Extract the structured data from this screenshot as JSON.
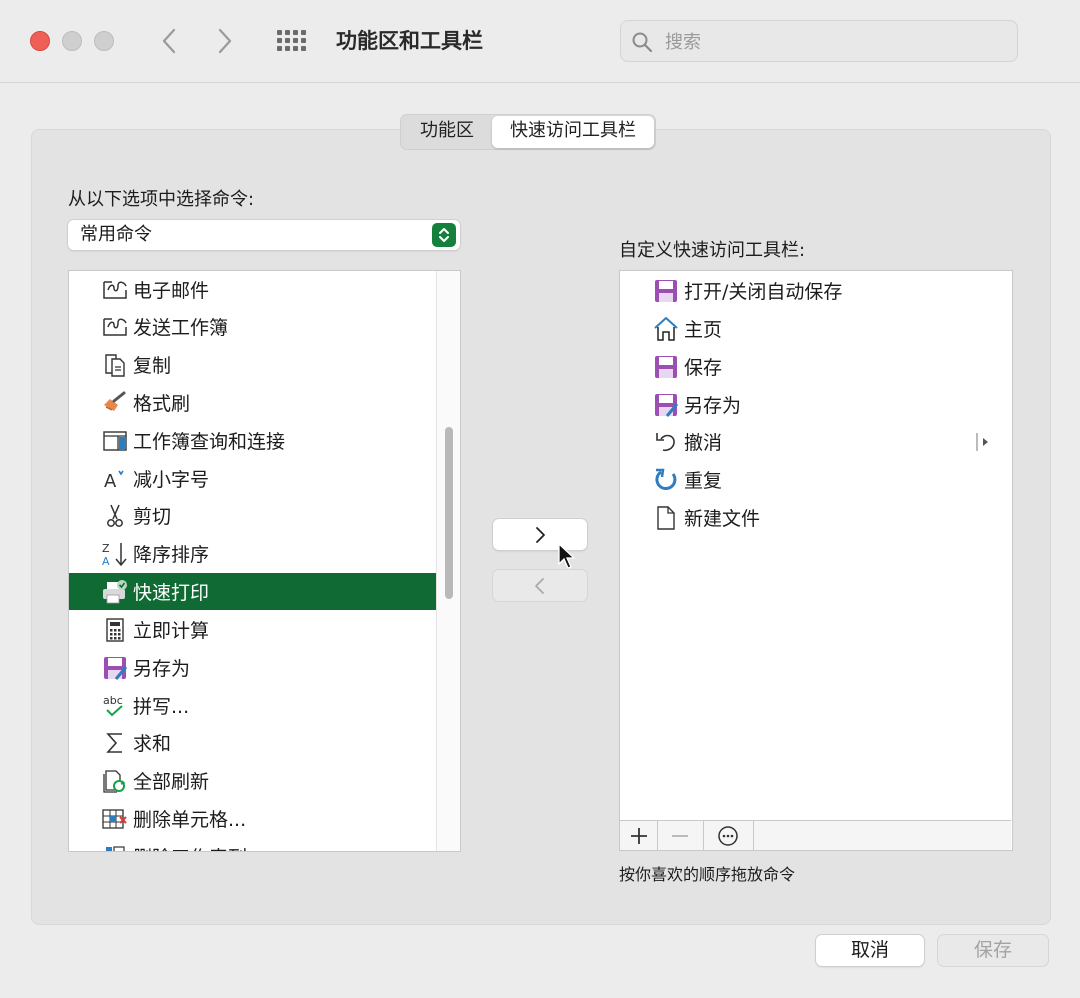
{
  "window": {
    "title": "功能区和工具栏"
  },
  "search": {
    "placeholder": "搜索"
  },
  "tabs": [
    {
      "label": "功能区",
      "active": false
    },
    {
      "label": "快速访问工具栏",
      "active": true
    }
  ],
  "left": {
    "label": "从以下选项中选择命令:",
    "dropdown_value": "常用命令",
    "items": [
      {
        "label": "电子邮件",
        "icon": "email-icon"
      },
      {
        "label": "发送工作簿",
        "icon": "send-workbook-icon"
      },
      {
        "label": "复制",
        "icon": "copy-icon"
      },
      {
        "label": "格式刷",
        "icon": "format-painter-icon"
      },
      {
        "label": "工作簿查询和连接",
        "icon": "queries-connections-icon"
      },
      {
        "label": "减小字号",
        "icon": "decrease-font-icon"
      },
      {
        "label": "剪切",
        "icon": "scissors-icon"
      },
      {
        "label": "降序排序",
        "icon": "sort-descending-icon"
      },
      {
        "label": "快速打印",
        "icon": "quick-print-icon",
        "selected": true
      },
      {
        "label": "立即计算",
        "icon": "calculator-icon"
      },
      {
        "label": "另存为",
        "icon": "save-as-icon"
      },
      {
        "label": "拼写...",
        "icon": "spelling-icon"
      },
      {
        "label": "求和",
        "icon": "sum-icon"
      },
      {
        "label": "全部刷新",
        "icon": "refresh-all-icon"
      },
      {
        "label": "删除单元格...",
        "icon": "delete-cells-icon"
      },
      {
        "label": "删除工作表列",
        "icon": "delete-column-icon"
      }
    ]
  },
  "right": {
    "label": "自定义快速访问工具栏:",
    "items": [
      {
        "label": "打开/关闭自动保存",
        "icon": "autosave-icon"
      },
      {
        "label": "主页",
        "icon": "home-icon"
      },
      {
        "label": "保存",
        "icon": "save-icon"
      },
      {
        "label": "另存为",
        "icon": "save-as-icon"
      },
      {
        "label": "撤消",
        "icon": "undo-icon"
      },
      {
        "label": "重复",
        "icon": "redo-icon"
      },
      {
        "label": "新建文件",
        "icon": "new-file-icon"
      }
    ],
    "hint": "按你喜欢的顺序拖放命令"
  },
  "buttons": {
    "cancel": "取消",
    "save": "保存"
  },
  "colors": {
    "selection": "#0f6b33",
    "accent_purple": "#9b4fb3",
    "accent_blue": "#2f7dc1"
  }
}
